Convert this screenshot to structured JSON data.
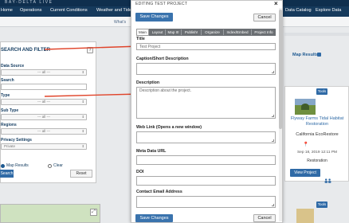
{
  "site": {
    "logo": "BAY-DELTA LIVE",
    "nav": [
      "Home",
      "Operations",
      "Current Conditions",
      "Weather and Tides",
      "Data Catalog",
      "Explore Data"
    ],
    "subnav_visible": "What's",
    "colors": {
      "nav": "#163a5c",
      "accent": "#2f6aa6"
    }
  },
  "filter_panel": {
    "title": "SEARCH AND FILTER",
    "help": "?",
    "data_source_label": "Data Source",
    "data_source_value": "--- all ---",
    "search_label": "Search",
    "search_value": "",
    "type_label": "Type",
    "type_value": "--- all ---",
    "subtype_label": "Sub Type",
    "subtype_value": "--- all ---",
    "regions_label": "Regions",
    "regions_value": "--- all ---",
    "privacy_label": "Privacy Settings",
    "privacy_value": "Private",
    "map_results_radio": "Map Results",
    "clear_radio": "Clear",
    "search_button": "Search",
    "reset_button": "Reset"
  },
  "results": {
    "map_results_label": "Map Results",
    "card": {
      "tools": "Tools",
      "title": "Flyway Farms Tidal Habitat Restoration",
      "org": "California EcoRestore",
      "date": "Sep 18, 2019 12:11 PM",
      "category": "Restoration",
      "view_button": "View Project"
    },
    "card2_tools": "Tools"
  },
  "modal": {
    "title": "EDITING TEST PROJECT",
    "close": "×",
    "save_label": "Save Changes",
    "cancel_label": "Cancel",
    "tabs": [
      "Main",
      "Layout",
      "Map It!",
      "Publish!",
      "Organize",
      "Index/Embed",
      "Project Info"
    ],
    "fields": {
      "title_label": "Title",
      "title_value": "Test Project",
      "caption_label": "Caption/Short Description",
      "caption_value": "",
      "description_label": "Description",
      "description_value": "Description about the project.",
      "weblink_label": "Web Link (Opens a new window)",
      "weblink_value": "",
      "metadata_label": "Meta Data URL",
      "metadata_value": "",
      "doi_label": "DOI",
      "doi_value": "",
      "contact_label": "Contact Email Address",
      "contact_value": ""
    }
  },
  "annotation_color": "#e0442a"
}
